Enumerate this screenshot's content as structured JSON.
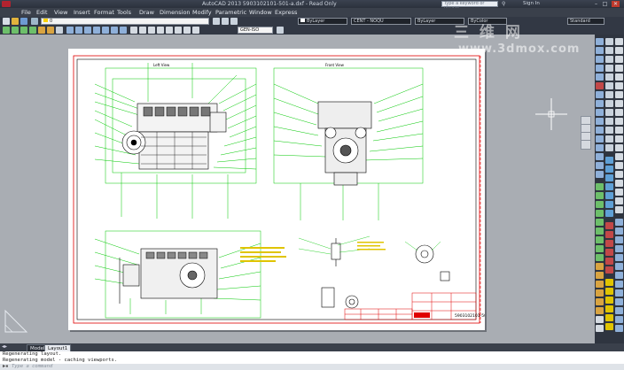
{
  "window": {
    "title": "AutoCAD 2013    5903102101-501-a.dxf - Read Only",
    "search_placeholder": "Type a keyword or phrase",
    "sign_in": "Sign In"
  },
  "menu": [
    "File",
    "Edit",
    "View",
    "Insert",
    "Format",
    "Tools",
    "Draw",
    "Dimension",
    "Modify",
    "Parametric",
    "Window",
    "Express"
  ],
  "toolbar": {
    "layer": "0",
    "color": "ByLayer",
    "linetype": "CENT - NOQU",
    "lineweight": "ByLayer",
    "plotstyle": "ByColor",
    "workspace": "Standard",
    "dimstyle": "GEN-ISO"
  },
  "tabs": [
    "Model",
    "Layout1"
  ],
  "command": {
    "history": [
      "Regenerating layout.",
      "Regenerating model - caching viewports."
    ],
    "prompt": "Type a command"
  },
  "watermark": {
    "line1": "三 维 网",
    "line2": "www.3dmox.com"
  },
  "drawing": {
    "view_labels": [
      "Left View",
      "Front View"
    ],
    "title_block": "5903102101-501"
  },
  "colors": {
    "drawing_line": "#00c800",
    "part_line": "#000000",
    "dim_red": "#e00000",
    "annotation_yellow": "#e0c400",
    "sheet": "#ffffff",
    "background": "#a9adb3"
  }
}
